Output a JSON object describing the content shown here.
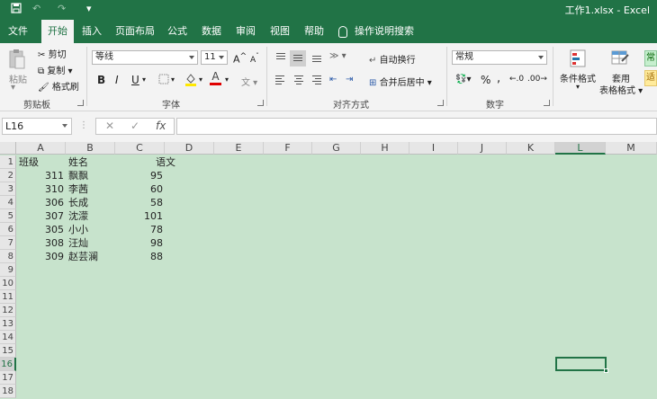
{
  "titlebar": {
    "title": "工作1.xlsx - Excel",
    "quick_access": [
      "save-icon",
      "undo-icon",
      "redo-icon",
      "customize-icon"
    ]
  },
  "tabs": [
    {
      "label": "文件",
      "active": false
    },
    {
      "label": "开始",
      "active": true
    },
    {
      "label": "插入",
      "active": false
    },
    {
      "label": "页面布局",
      "active": false
    },
    {
      "label": "公式",
      "active": false
    },
    {
      "label": "数据",
      "active": false
    },
    {
      "label": "审阅",
      "active": false
    },
    {
      "label": "视图",
      "active": false
    },
    {
      "label": "帮助",
      "active": false
    }
  ],
  "tell_me": "操作说明搜索",
  "ribbon": {
    "clipboard": {
      "paste": "粘贴",
      "cut": "剪切",
      "copy": "复制",
      "format_painter": "格式刷",
      "label": "剪贴板"
    },
    "font": {
      "font_name": "等线",
      "font_size": "11",
      "bold": "B",
      "italic": "I",
      "underline": "U",
      "font_color_letter": "A",
      "grow": "A",
      "shrink": "A",
      "label": "字体"
    },
    "alignment": {
      "wrap_text": "自动换行",
      "merge_center": "合并后居中",
      "label": "对齐方式"
    },
    "number": {
      "format": "常规",
      "percent": "%",
      "comma": ",",
      "label": "数字"
    },
    "styles": {
      "conditional": "条件格式",
      "table_format_1": "套用",
      "table_format_2": "表格格式",
      "style_normal": "常",
      "style_bad": "适"
    }
  },
  "formula_bar": {
    "name_box": "L16",
    "cancel": "✕",
    "enter": "✓",
    "fx": "fx",
    "content": ""
  },
  "sheet": {
    "columns": [
      "A",
      "B",
      "C",
      "D",
      "E",
      "F",
      "G",
      "H",
      "I",
      "J",
      "K",
      "L",
      "M"
    ],
    "rows": [
      "1",
      "2",
      "3",
      "4",
      "5",
      "6",
      "7",
      "8",
      "9",
      "10",
      "11",
      "12",
      "13",
      "14",
      "15",
      "16",
      "17",
      "18"
    ],
    "selected_cell": "L16",
    "header": {
      "a": "班级",
      "b": "姓名",
      "c": "语文"
    },
    "records": [
      {
        "a": "311",
        "b": "飘飘",
        "c": "95"
      },
      {
        "a": "310",
        "b": "李茜",
        "c": "60"
      },
      {
        "a": "306",
        "b": "长成",
        "c": "58"
      },
      {
        "a": "307",
        "b": "沈濛",
        "c": "101"
      },
      {
        "a": "305",
        "b": "小小",
        "c": "78"
      },
      {
        "a": "308",
        "b": "汪灿",
        "c": "98"
      },
      {
        "a": "309",
        "b": "赵芸澜",
        "c": "88"
      }
    ]
  },
  "colors": {
    "accent": "#217346",
    "sheet_fill": "#c7e3cc"
  }
}
